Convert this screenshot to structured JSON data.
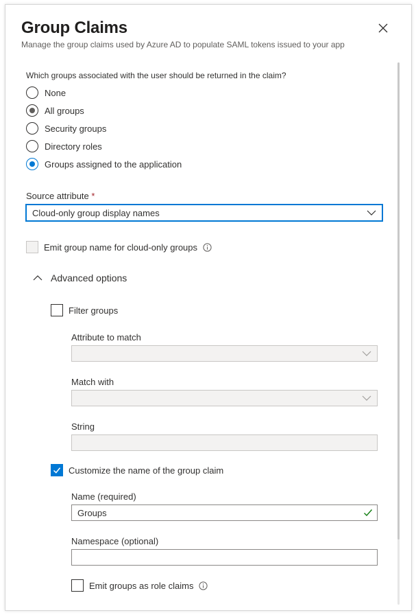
{
  "header": {
    "title": "Group Claims",
    "subtitle": "Manage the group claims used by Azure AD to populate SAML tokens issued to your app"
  },
  "question": "Which groups associated with the user should be returned in the claim?",
  "group_options": [
    {
      "label": "None",
      "state": "unselected"
    },
    {
      "label": "All groups",
      "state": "selected-grey"
    },
    {
      "label": "Security groups",
      "state": "unselected"
    },
    {
      "label": "Directory roles",
      "state": "unselected"
    },
    {
      "label": "Groups assigned to the application",
      "state": "selected"
    }
  ],
  "source_attribute": {
    "label": "Source attribute",
    "required_mark": "*",
    "value": "Cloud-only group display names"
  },
  "emit_cloud_only": {
    "label": "Emit group name for cloud-only groups",
    "checked": false,
    "disabled": true
  },
  "advanced": {
    "label": "Advanced options",
    "expanded": true,
    "filter_groups": {
      "label": "Filter groups",
      "checked": false,
      "attribute_to_match_label": "Attribute to match",
      "attribute_to_match_value": "",
      "match_with_label": "Match with",
      "match_with_value": "",
      "string_label": "String",
      "string_value": ""
    },
    "customize_name": {
      "label": "Customize the name of the group claim",
      "checked": true,
      "name_label": "Name (required)",
      "name_value": "Groups",
      "namespace_label": "Namespace (optional)",
      "namespace_value": "",
      "emit_role_claims_label": "Emit groups as role claims",
      "emit_role_claims_checked": false
    }
  },
  "colors": {
    "accent": "#0078d4",
    "valid": "#107c10",
    "text": "#323130",
    "muted": "#605e5c",
    "disabled_bg": "#f3f2f1"
  },
  "icons": {
    "close": "close-icon",
    "chevron": "chevron-down-icon",
    "collapse": "chevron-up-icon",
    "info": "info-icon",
    "checkmark": "checkmark-icon"
  }
}
